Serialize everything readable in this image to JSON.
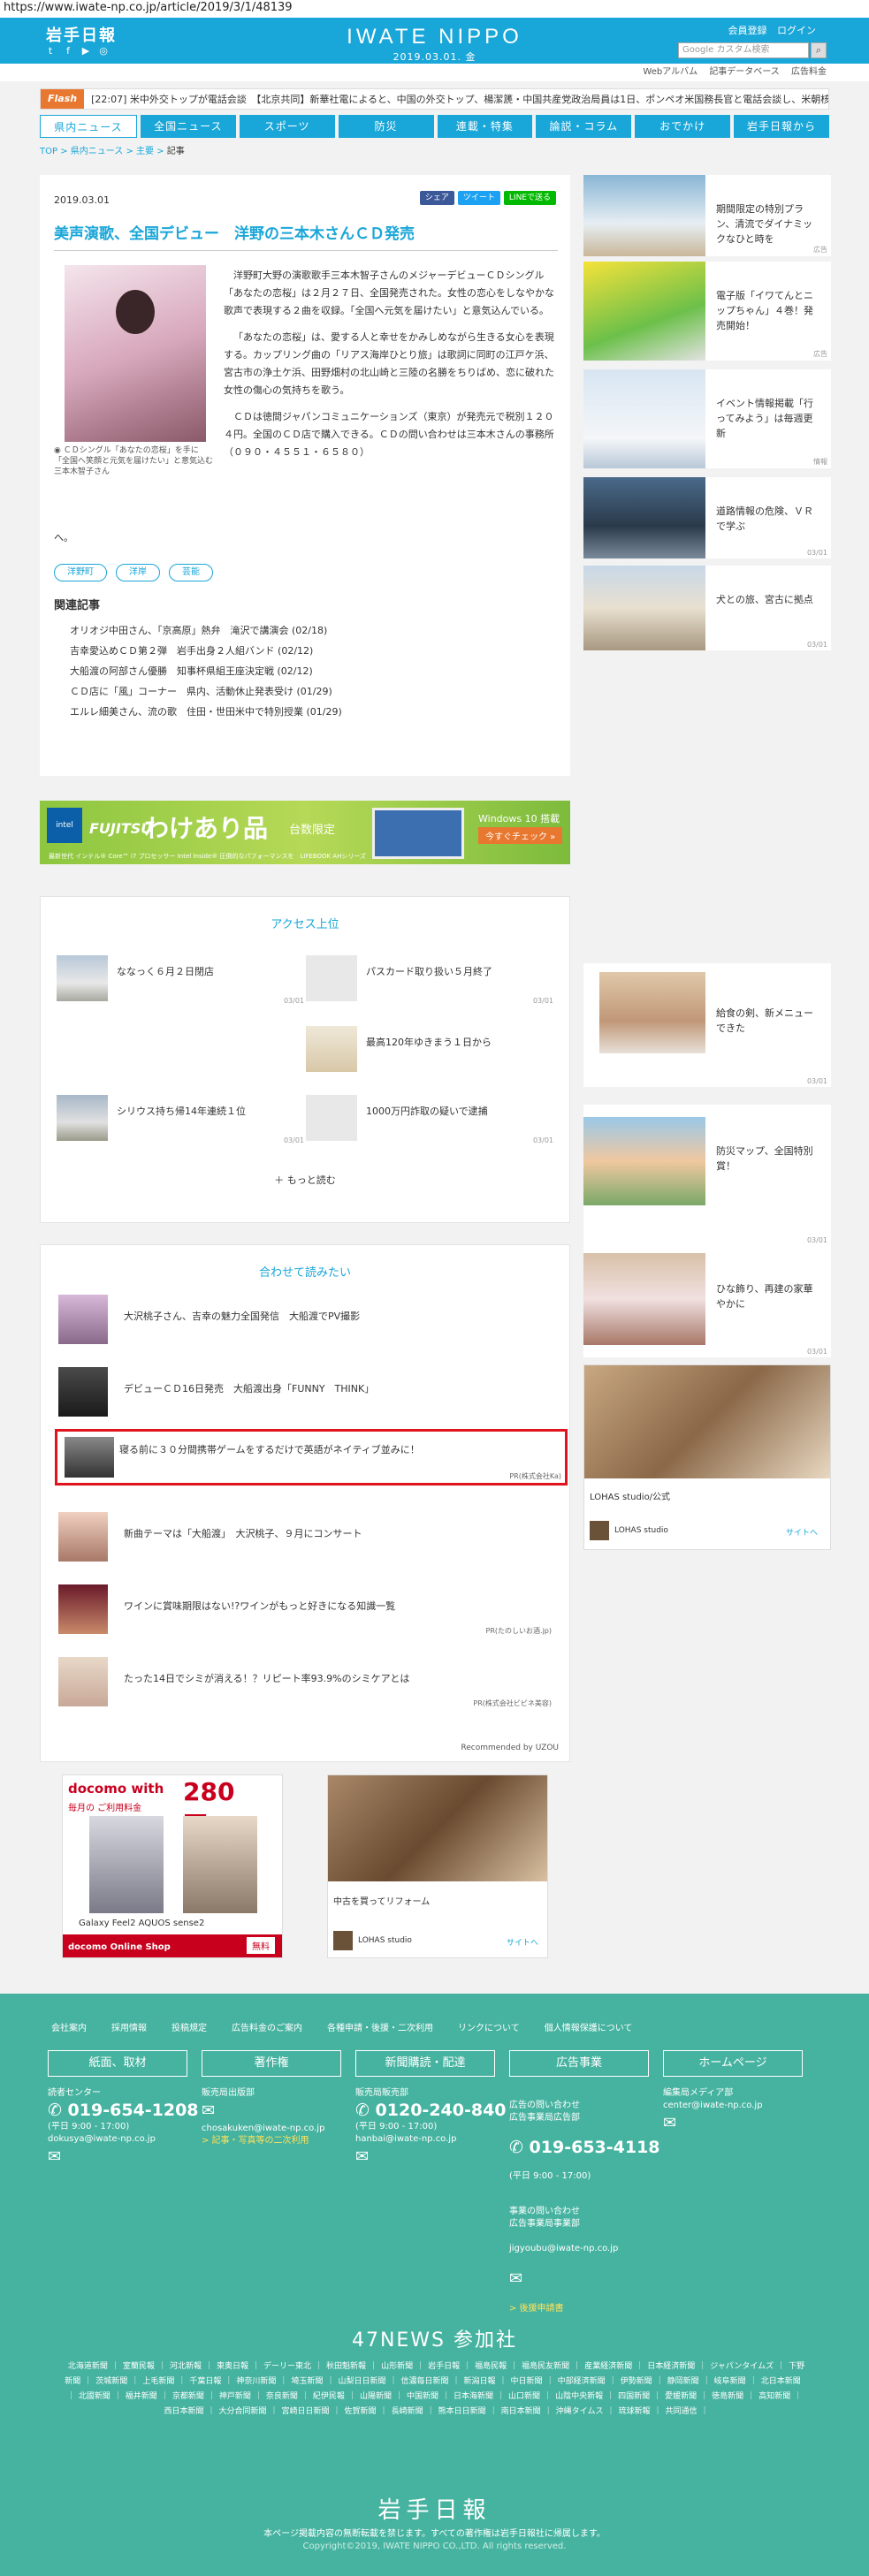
{
  "url": "https://www.iwate-np.co.jp/article/2019/3/1/48139",
  "header": {
    "logo": "岩手日報",
    "center_logo": "IWATE NIPPO",
    "date": "2019.03.01. 金",
    "member_register": "会員登録",
    "login": "ログイン",
    "search_placeholder": "Google カスタム検索",
    "social": [
      "t",
      "f",
      "▶",
      "◎"
    ]
  },
  "subnav": [
    "Webアルバム",
    "記事データベース",
    "広告料金"
  ],
  "flash": {
    "label": "Flash",
    "text": "[22:07] 米中外交トップが電話会談　【北京共同】新華社電によると、中国の外交トップ、楊潔篪・中国共産党政治局員は1日、ポンペオ米国務長官と電話会談し、米朝核..."
  },
  "nav": [
    "県内ニュース",
    "全国ニュース",
    "スポーツ",
    "防災",
    "連載・特集",
    "論説・コラム",
    "おでかけ",
    "岩手日報から"
  ],
  "breadcrumb": [
    "TOP",
    "県内ニュース",
    "主要",
    "記事"
  ],
  "article": {
    "date": "2019.03.01",
    "share": {
      "facebook": "シェア",
      "twitter": "ツイート",
      "line": "LINEで送る"
    },
    "title": "美声演歌、全国デビュー　洋野の三本木さんＣＤ発売",
    "caption": "ＣＤシングル「あなたの恋桜」を手に「全国へ笑顔と元気を届けたい」と意気込む三本木智子さん",
    "paragraphs": [
      "洋野町大野の演歌歌手三本木智子さんのメジャーデビューＣＤシングル「あなたの恋桜」は２月２７日、全国発売された。女性の恋心をしなやかな歌声で表現する２曲を収録。「全国へ元気を届けたい」と意気込んでいる。",
      "「あなたの恋桜」は、愛する人と幸せをかみしめながら生きる女心を表現する。カップリング曲の「リアス海岸ひとり旅」は歌詞に同町の江戸ケ浜、宮古市の浄土ケ浜、田野畑村の北山崎と三陸の名勝をちりばめ、恋に破れた女性の傷心の気持ちを歌う。",
      "ＣＤは徳間ジャパンコミュニケーションズ（東京）が発売元で税別１２０４円。全国のＣＤ店で購入できる。ＣＤの問い合わせは三本木さんの事務所（０９０・４５５１・６５８０）"
    ],
    "tail": "へ。",
    "tags": [
      "洋野町",
      "洋岸",
      "芸能"
    ],
    "related_title": "関連記事",
    "related": [
      "オリオジ中田さん、「京高原」熱弁　滝沢で講演会 (02/18)",
      "吉幸愛込めＣＤ第２弾　岩手出身２人組バンド (02/12)",
      "大船渡の阿部さん優勝　知事杯県組王座決定戦 (02/12)",
      "ＣＤ店に「風」コーナー　県内、活動休止発表受け (01/29)",
      "エルレ細美さん、流の歌　住田・世田米中で特別授業 (01/29)"
    ]
  },
  "banner": {
    "chip": "intel",
    "brand": "FUJITSU",
    "headline": "わけあり品",
    "tag": "台数限定",
    "os": "Windows 10 搭載",
    "cta": "今すぐチェック »",
    "fine": "最新世代 インテル® Core™ i7 プロセッサー  Intel Inside® 圧倒的なパフォーマンスを　LIFEBOOK AHシリーズ"
  },
  "sidebar": [
    {
      "text": "期間限定の特別プラン、清流でダイナミックなひと時を",
      "date": "広告"
    },
    {
      "text": "電子版「イワてんとニップちゃん」４巻！発売開始！",
      "date": "広告"
    },
    {
      "text": "イベント情報掲載「行ってみよう」は毎週更新",
      "date": "情報"
    },
    {
      "text": "道路情報の危険、ＶＲで学ぶ",
      "date": "03/01"
    },
    {
      "text": "犬との旅、宮古に拠点",
      "date": "03/01"
    },
    {
      "text": "給食の剣、新メニューできた",
      "date": "03/01"
    },
    {
      "text": "防災マップ、全国特別賞！",
      "date": "03/01"
    },
    {
      "text": "ひな飾り、再建の家華やかに",
      "date": "03/01"
    }
  ],
  "side_ad": {
    "name": "LOHAS studio/公式",
    "brand": "LOHAS studio",
    "cta": "サイトへ"
  },
  "ranking": {
    "title": "アクセス上位",
    "items": [
      {
        "text": "ななっく６月２日閉店",
        "date": "03/01"
      },
      {
        "text": "パスカード取り扱い５月終了",
        "date": "03/01"
      },
      {
        "text": "最高120年ゆきまう１日から",
        "date": "03/01"
      },
      {
        "text": "シリウス持ち帰14年連続１位",
        "date": "03/01"
      },
      {
        "text": "1000万円詐取の疑いで逮捕",
        "date": "03/01"
      }
    ],
    "more": "もっと読む"
  },
  "recommend": {
    "title": "合わせて読みたい",
    "items": [
      {
        "text": "大沢桃子さん、吉幸の魅力全国発信　大船渡でPV撮影",
        "pr": ""
      },
      {
        "text": "デビューＣＤ16日発売　大船渡出身「FUNNY　THINK」",
        "pr": ""
      },
      {
        "text": "寝る前に３０分間携帯ゲームをするだけで英語がネイティブ並みに！",
        "pr": "PR(株式会社Ka)"
      },
      {
        "text": "新曲テーマは「大船渡」　大沢桃子、９月にコンサート",
        "pr": ""
      },
      {
        "text": "ワインに賞味期限はない!?ワインがもっと好きになる知識一覧",
        "pr": "PR(たのしいお酒.jp)"
      },
      {
        "text": "たった14日でシミが消える！？リピート率93.9%のシミケアとは",
        "pr": "PR(株式会社ビビネ美容)"
      }
    ],
    "powered": "Recommended by  UZOU"
  },
  "docomo_ad": {
    "brand": "docomo with",
    "headline": "280円〜",
    "sub": "毎月の ご利用料金",
    "phones": "Galaxy Feel2     AQUOS sense2",
    "shop": "docomo Online Shop",
    "cta": "無料"
  },
  "lohas_ad": {
    "caption": "中古を買ってリフォーム",
    "brand": "LOHAS studio",
    "cta": "サイトへ"
  },
  "footer": {
    "links": [
      "会社案内",
      "採用情報",
      "投稿規定",
      "広告料金のご案内",
      "各種申請・後援・二次利用",
      "リンクについて",
      "個人情報保護について"
    ],
    "heads": [
      "紙面、取材",
      "著作権",
      "新聞購読・配達",
      "広告事業",
      "ホームページ"
    ],
    "col1": {
      "label": "読者センター",
      "tel": "019-654-1208",
      "hours": "(平日 9:00 - 17:00)",
      "email": "dokusya@iwate-np.co.jp"
    },
    "col2": {
      "label": "販売局出版部",
      "email": "chosakuken@iwate-np.co.jp",
      "link": "> 記事・写真等の二次利用"
    },
    "col3": {
      "label": "販売局販売部",
      "tel": "0120-240-840",
      "hours": "(平日 9:00 - 17:00)",
      "email": "hanbai@iwate-np.co.jp"
    },
    "col4": {
      "label": "広告の問い合わせ\n広告事業局広告部",
      "tel": "019-653-4118",
      "hours": "(平日 9:00 - 17:00)",
      "label2": "事業の問い合わせ\n広告事業局事業部",
      "email": "jigyoubu@iwate-np.co.jp",
      "link": "> 後援申請書"
    },
    "col5": {
      "label": "編集局メディア部",
      "email": "center@iwate-np.co.jp"
    },
    "news47": "47NEWS 参加社",
    "papers": [
      "北海道新聞",
      "室蘭民報",
      "河北新報",
      "東奥日報",
      "デーリー東北",
      "秋田魁新報",
      "山形新聞",
      "岩手日報",
      "福島民報",
      "福島民友新聞",
      "産業経済新聞",
      "日本経済新聞",
      "ジャパンタイムズ",
      "下野新聞",
      "茨城新聞",
      "上毛新聞",
      "千葉日報",
      "神奈川新聞",
      "埼玉新聞",
      "山梨日日新聞",
      "信濃毎日新聞",
      "新潟日報",
      "中日新聞",
      "中部経済新聞",
      "伊勢新聞",
      "静岡新聞",
      "岐阜新聞",
      "北日本新聞",
      "北國新聞",
      "福井新聞",
      "京都新聞",
      "神戸新聞",
      "奈良新聞",
      "紀伊民報",
      "山陽新聞",
      "中国新聞",
      "日本海新聞",
      "山口新聞",
      "山陰中央新報",
      "四国新聞",
      "愛媛新聞",
      "徳島新聞",
      "高知新聞",
      "西日本新聞",
      "大分合同新聞",
      "宮崎日日新聞",
      "佐賀新聞",
      "長崎新聞",
      "熊本日日新聞",
      "南日本新聞",
      "沖縄タイムス",
      "琉球新報",
      "共同通信"
    ],
    "logo": "岩手日報",
    "note": "本ページ掲載内容の無断転載を禁じます。すべての著作権は岩手日報社に帰属します。",
    "copyright": "Copyright©2019, IWATE NIPPO CO.,LTD. All rights reserved."
  }
}
